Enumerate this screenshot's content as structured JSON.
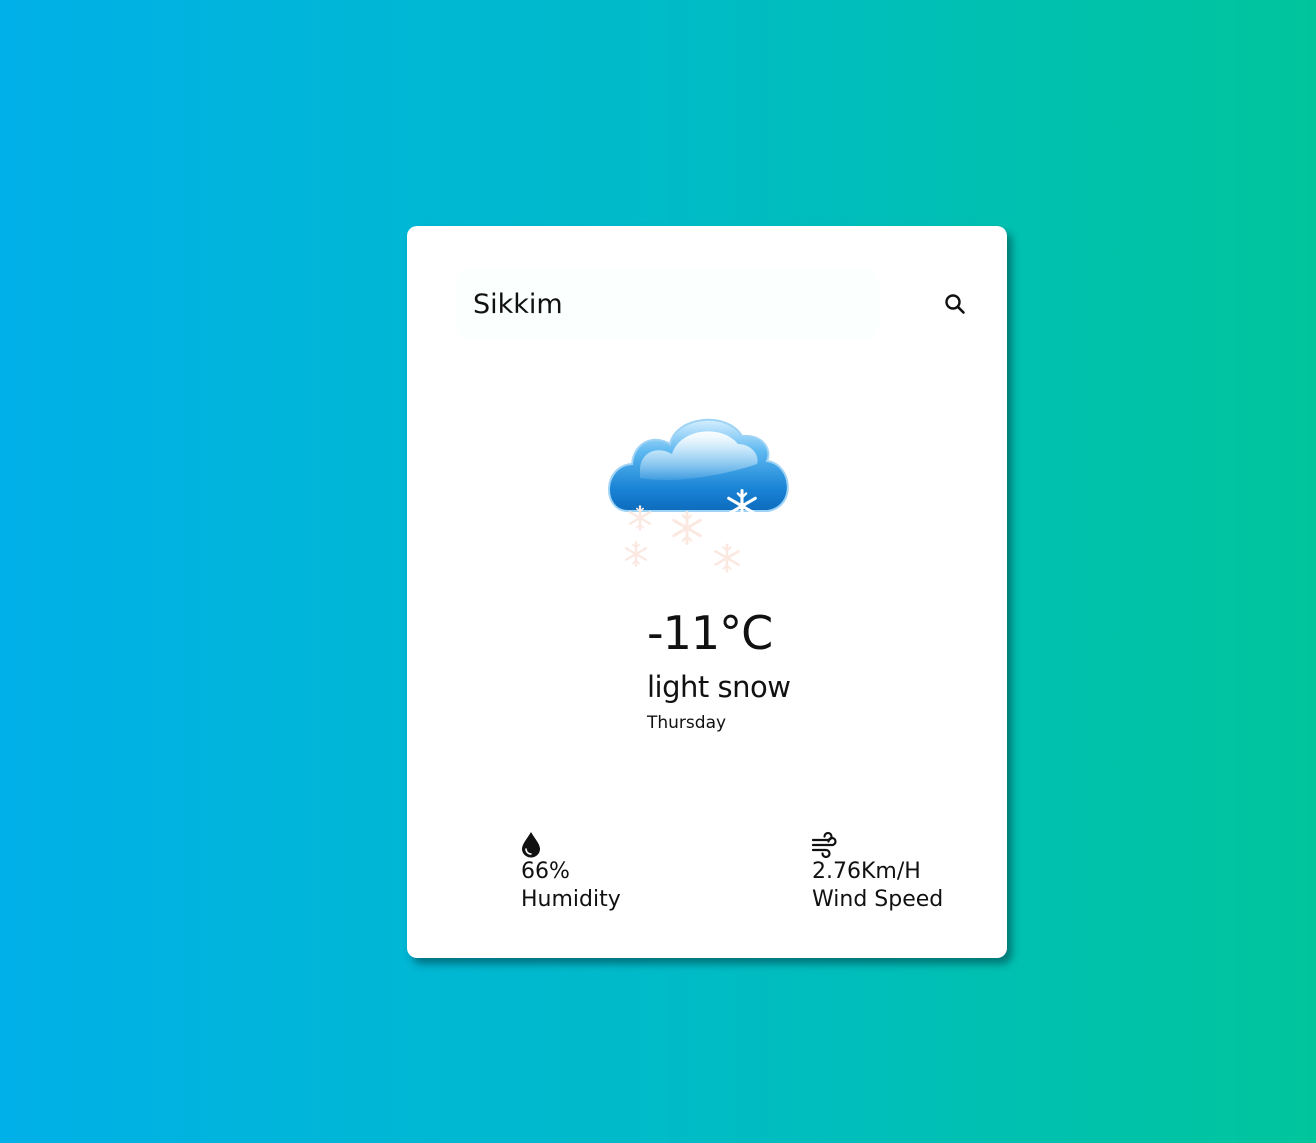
{
  "search": {
    "value": "Sikkim",
    "icon": "search-icon"
  },
  "weather": {
    "icon": "cloud-snow-icon",
    "temperature": "-11°C",
    "description": "light snow",
    "day": "Thursday"
  },
  "humidity": {
    "icon": "droplet-icon",
    "value": "66%",
    "label": "Humidity"
  },
  "wind": {
    "icon": "wind-icon",
    "value": "2.76Km/H",
    "label": "Wind Speed"
  },
  "colors": {
    "background_start": "#00b0e8",
    "background_end": "#00c59c",
    "card": "#ffffff",
    "cloud": "#1a8fdc"
  }
}
